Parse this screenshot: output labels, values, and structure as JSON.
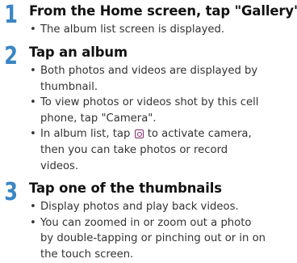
{
  "steps": [
    {
      "number": "1",
      "title": "From the Home screen, tap \"Gallery\"",
      "bullets": [
        [
          "The album list screen is displayed."
        ]
      ]
    },
    {
      "number": "2",
      "title": "Tap an album",
      "bullets": [
        [
          "Both photos and videos are displayed by",
          "thumbnail."
        ],
        [
          "To view photos or videos shot by this cell",
          "phone, tap \"Camera\"."
        ],
        [
          "In album list, tap",
          "to activate camera,",
          "then you can take photos or record",
          "videos."
        ]
      ]
    },
    {
      "number": "3",
      "title": "Tap one of the thumbnails",
      "bullets": [
        [
          "Display photos and play back videos."
        ],
        [
          "You can zoomed in or zoom out a photo",
          "by double-tapping or pinching out or in on",
          "the touch screen."
        ]
      ]
    }
  ],
  "icons": {
    "camera": "camera-icon",
    "bullet": "•"
  },
  "colors": {
    "step_number": "#3b86c3",
    "icon": "#8a2a6d"
  }
}
